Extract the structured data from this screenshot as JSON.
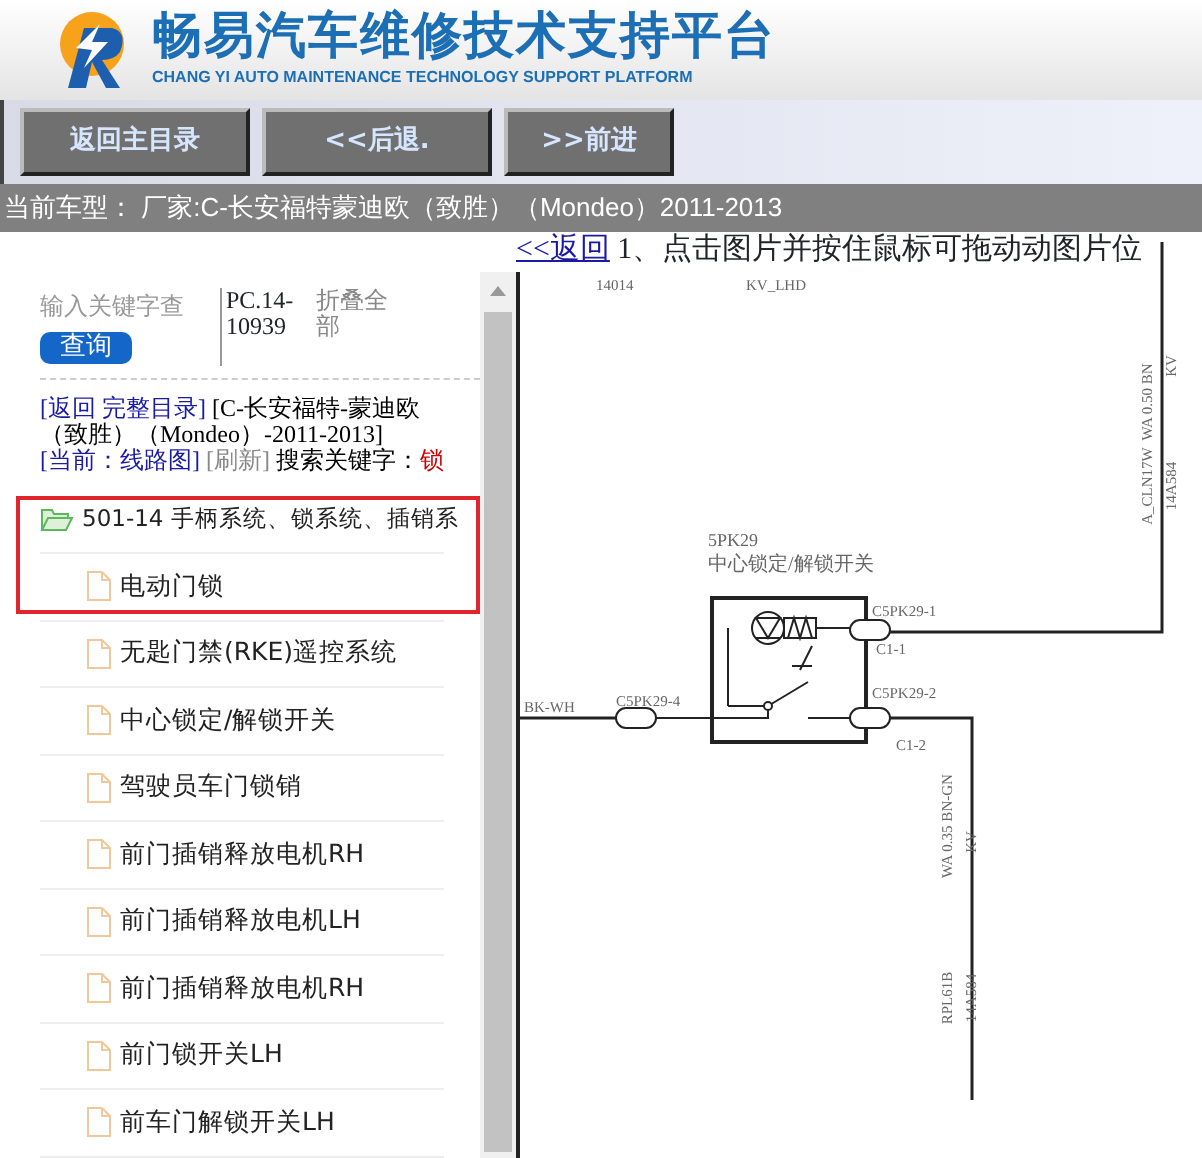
{
  "header": {
    "title": "畅易汽车维修技术支持平台",
    "subtitle": "CHANG YI AUTO MAINTENANCE TECHNOLOGY SUPPORT PLATFORM"
  },
  "nav_buttons": [
    "返回主目录",
    "<<后退.",
    ">>前进"
  ],
  "vehicle_bar": "当前车型：  厂家:C-长安福特蒙迪欧（致胜）（Mondeo）2011-2013",
  "sidebar": {
    "search": {
      "placeholder": "输入关键字查",
      "button": "查询"
    },
    "code": "PC.14-10939",
    "collapse": "折叠全部",
    "breadcrumb": [
      {
        "kind": "link",
        "text": "[返回 完整目录]"
      },
      {
        "kind": "text",
        "text": "[C-长安福特-蒙迪欧（致胜）（Mondeo）-2011-2013]"
      },
      {
        "kind": "link",
        "text": "[当前：线路图]"
      },
      {
        "kind": "muted",
        "text": "[刷新]"
      },
      {
        "kind": "text",
        "text": "搜索关键字："
      },
      {
        "kind": "keyword",
        "text": "锁"
      }
    ],
    "tree": [
      {
        "label": "501-14 手柄系统、锁系统、插销系",
        "expanded": true,
        "children": [
          {
            "label": "电动门锁"
          },
          {
            "label": "无匙门禁(RKE)遥控系统"
          },
          {
            "label": "中心锁定/解锁开关"
          },
          {
            "label": "驾驶员车门锁销"
          },
          {
            "label": "前门插销释放电机RH"
          },
          {
            "label": "前门插销释放电机LH"
          },
          {
            "label": "前门插销释放电机RH"
          },
          {
            "label": "前门锁开关LH"
          },
          {
            "label": "前车门解锁开关LH"
          }
        ]
      }
    ]
  },
  "viewer": {
    "back_link": "<<返回",
    "hint": "1、点击图片并按住鼠标可拖动动图片位",
    "diagram": {
      "component_code": "5PK29",
      "component_name": "中心锁定/解锁开关",
      "labels": [
        "14014",
        "KV_LHD",
        "WA  0.50  BN",
        "KV",
        "A_CLN17W",
        "14A584",
        "C5PK29-1",
        "C1-1",
        "C5PK29-4",
        "BK-WH",
        "C5PK29-2",
        "C1-2",
        "WA  0.35  BN-GN",
        "KV",
        "RPL61B",
        "14A584"
      ]
    }
  }
}
